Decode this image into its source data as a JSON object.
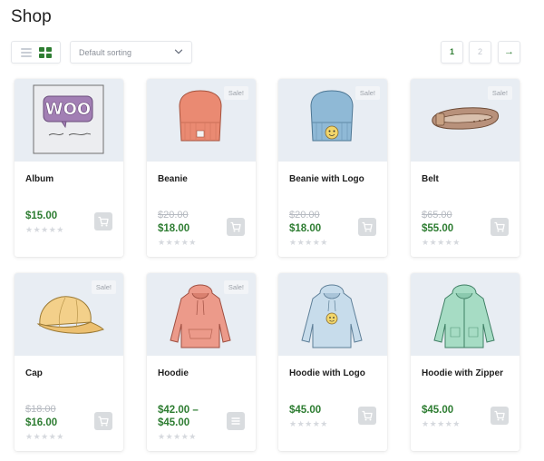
{
  "page": {
    "title": "Shop"
  },
  "toolbar": {
    "sort_selected": "Default sorting",
    "pagination": {
      "page_1": "1",
      "page_2": "2",
      "next": "→"
    }
  },
  "colors": {
    "accent": "#2e7d32",
    "sale_text": "#b6bac1",
    "thumb_bg": "#e8edf3"
  },
  "products": [
    {
      "name": "Album",
      "sale_badge": "",
      "old_price": "",
      "price": "$15.00",
      "rating": "★★★★★",
      "image": "album-art",
      "action_icon": "cart-icon"
    },
    {
      "name": "Beanie",
      "sale_badge": "Sale!",
      "old_price": "$20.00",
      "price": "$18.00",
      "rating": "★★★★★",
      "image": "beanie",
      "action_icon": "cart-icon"
    },
    {
      "name": "Beanie with Logo",
      "sale_badge": "Sale!",
      "old_price": "$20.00",
      "price": "$18.00",
      "rating": "★★★★★",
      "image": "beanie-logo",
      "action_icon": "cart-icon"
    },
    {
      "name": "Belt",
      "sale_badge": "Sale!",
      "old_price": "$65.00",
      "price": "$55.00",
      "rating": "★★★★★",
      "image": "belt",
      "action_icon": "cart-icon"
    },
    {
      "name": "Cap",
      "sale_badge": "Sale!",
      "old_price": "$18.00",
      "price": "$16.00",
      "rating": "★★★★★",
      "image": "cap",
      "action_icon": "cart-icon"
    },
    {
      "name": "Hoodie",
      "sale_badge": "Sale!",
      "old_price": "",
      "price_line1": "$42.00 –",
      "price_line2": "$45.00",
      "rating": "★★★★★",
      "image": "hoodie",
      "action_icon": "options-icon"
    },
    {
      "name": "Hoodie with Logo",
      "sale_badge": "",
      "old_price": "",
      "price": "$45.00",
      "rating": "★★★★★",
      "image": "hoodie-logo",
      "action_icon": "cart-icon"
    },
    {
      "name": "Hoodie with Zipper",
      "sale_badge": "",
      "old_price": "",
      "price": "$45.00",
      "rating": "★★★★★",
      "image": "hoodie-zipper",
      "action_icon": "cart-icon"
    }
  ]
}
